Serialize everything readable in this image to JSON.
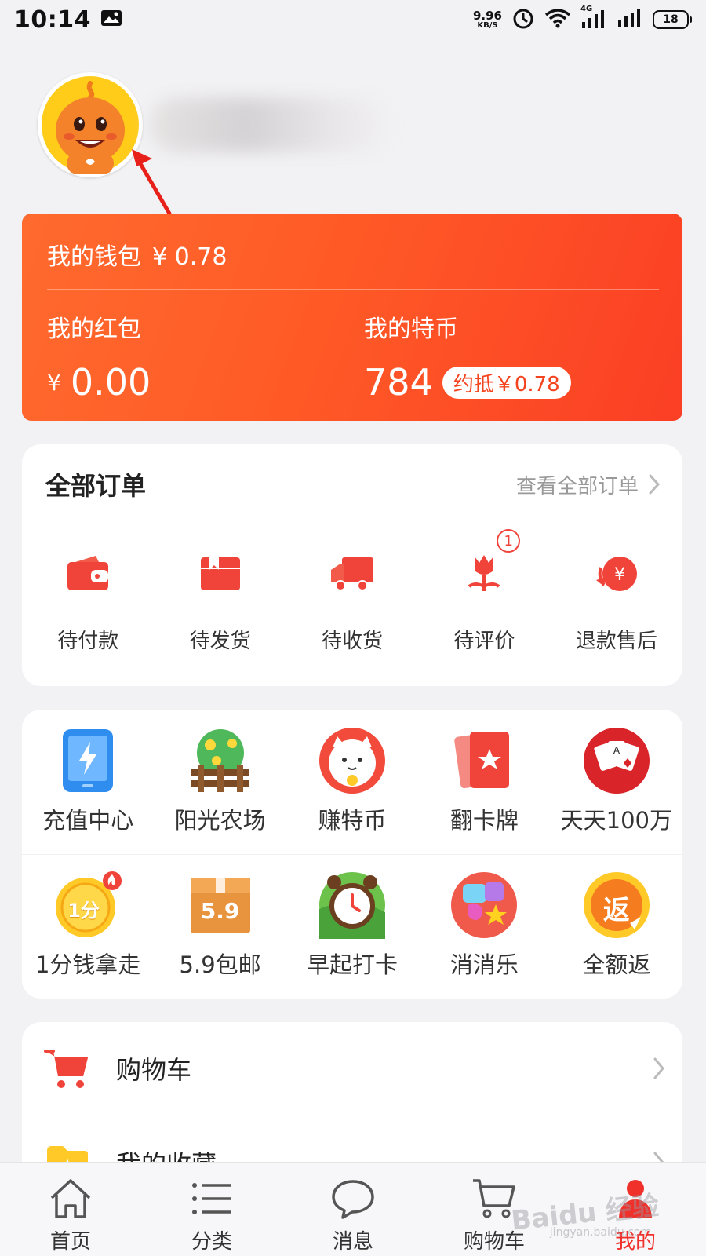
{
  "status_bar": {
    "time": "10:14",
    "net_speed_value": "9.96",
    "net_speed_unit": "KB/S",
    "network_type": "4G",
    "battery": "18"
  },
  "profile": {
    "username": ""
  },
  "wallet": {
    "label": "我的钱包",
    "amount": "¥ 0.78",
    "redpacket_label": "我的红包",
    "redpacket_yen": "¥",
    "redpacket_amount": "0.00",
    "coin_label": "我的特币",
    "coin_amount": "784",
    "coin_equiv": "约抵￥0.78"
  },
  "orders": {
    "title": "全部订单",
    "view_all": "查看全部订单",
    "items": [
      {
        "label": "待付款",
        "icon": "wallet-icon"
      },
      {
        "label": "待发货",
        "icon": "box-icon"
      },
      {
        "label": "待收货",
        "icon": "truck-icon"
      },
      {
        "label": "待评价",
        "icon": "flower-icon",
        "badge": "1"
      },
      {
        "label": "退款售后",
        "icon": "refund-icon"
      }
    ]
  },
  "services": {
    "row1": [
      {
        "label": "充值中心",
        "icon": "phone-recharge-icon"
      },
      {
        "label": "阳光农场",
        "icon": "farm-tree-icon"
      },
      {
        "label": "赚特币",
        "icon": "lucky-cat-icon"
      },
      {
        "label": "翻卡牌",
        "icon": "cards-icon"
      },
      {
        "label": "天天100万",
        "icon": "poker-icon"
      }
    ],
    "row2": [
      {
        "label": "1分钱拿走",
        "icon": "one-cent-coin-icon",
        "coin_text": "1分"
      },
      {
        "label": "5.9包邮",
        "icon": "parcel-icon",
        "box_text": "5.9"
      },
      {
        "label": "早起打卡",
        "icon": "alarm-clock-icon"
      },
      {
        "label": "消消乐",
        "icon": "candy-icon"
      },
      {
        "label": "全额返",
        "icon": "cashback-icon",
        "coin_text": "返"
      }
    ]
  },
  "list": {
    "items": [
      {
        "label": "购物车",
        "icon": "cart-icon"
      },
      {
        "label": "我的收藏",
        "icon": "folder-star-icon"
      }
    ]
  },
  "bottom_nav": {
    "items": [
      {
        "label": "首页",
        "icon": "home-icon"
      },
      {
        "label": "分类",
        "icon": "list-icon"
      },
      {
        "label": "消息",
        "icon": "chat-bubble-icon"
      },
      {
        "label": "购物车",
        "icon": "cart-outline-icon"
      },
      {
        "label": "我的",
        "icon": "person-icon"
      }
    ],
    "active_index": 4
  },
  "watermark": {
    "brand": "Baidu 经验",
    "url": "jingyan.baidu.com"
  },
  "colors": {
    "accent": "#f0302a",
    "wallet_start": "#ff6a2e",
    "wallet_end": "#fb3f25",
    "background": "#f2f2f4"
  }
}
